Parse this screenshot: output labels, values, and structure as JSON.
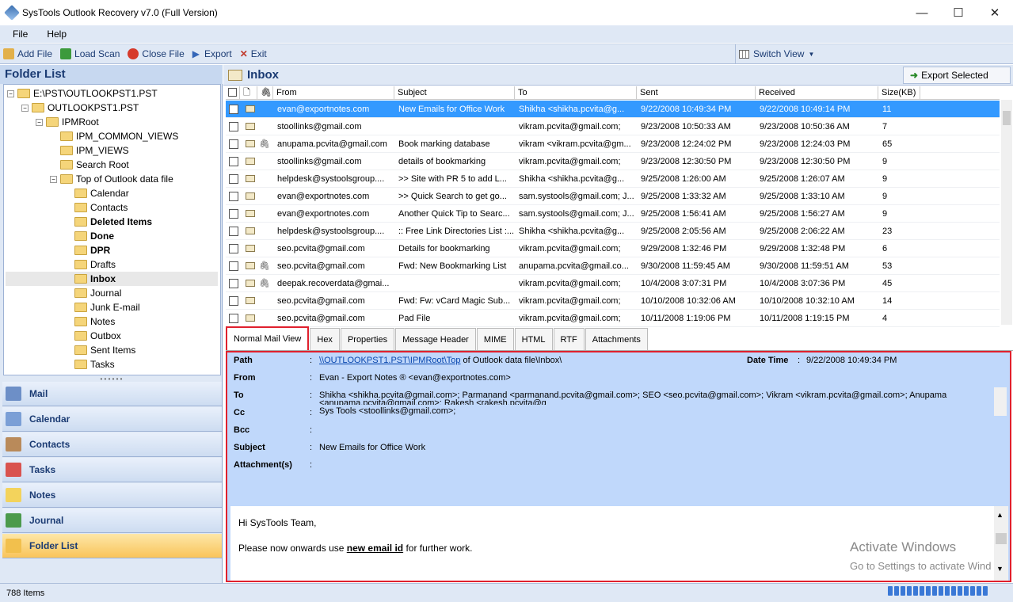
{
  "window": {
    "title": "SysTools Outlook Recovery v7.0 (Full Version)"
  },
  "menu": [
    "File",
    "Help"
  ],
  "toolbar": {
    "items": [
      {
        "label": "Add File",
        "icon": "open-folder-icon",
        "color": "#e2b04a"
      },
      {
        "label": "Load Scan",
        "icon": "download-icon",
        "color": "#3c9a3c"
      },
      {
        "label": "Close File",
        "icon": "close-circle-icon",
        "color": "#d63a2b"
      },
      {
        "label": "Export",
        "icon": "play-arrow-icon",
        "color": "#3466b8"
      },
      {
        "label": "Exit",
        "icon": "cross-icon",
        "color": "#c0392b"
      }
    ],
    "switch_view": "Switch View"
  },
  "folder_list": {
    "title": "Folder List",
    "tree": [
      {
        "label": "E:\\PST\\OUTLOOKPST1.PST",
        "level": 0,
        "exp": "−",
        "bold": false
      },
      {
        "label": "OUTLOOKPST1.PST",
        "level": 1,
        "exp": "−",
        "bold": false
      },
      {
        "label": "IPMRoot",
        "level": 2,
        "exp": "−",
        "bold": false
      },
      {
        "label": "IPM_COMMON_VIEWS",
        "level": 3,
        "exp": "",
        "bold": false
      },
      {
        "label": "IPM_VIEWS",
        "level": 3,
        "exp": "",
        "bold": false
      },
      {
        "label": "Search Root",
        "level": 3,
        "exp": "",
        "bold": false
      },
      {
        "label": "Top of Outlook data file",
        "level": 3,
        "exp": "−",
        "bold": false
      },
      {
        "label": "Calendar",
        "level": 4,
        "exp": "",
        "bold": false
      },
      {
        "label": "Contacts",
        "level": 4,
        "exp": "",
        "bold": false
      },
      {
        "label": "Deleted Items",
        "level": 4,
        "exp": "",
        "bold": true
      },
      {
        "label": "Done",
        "level": 4,
        "exp": "",
        "bold": true
      },
      {
        "label": "DPR",
        "level": 4,
        "exp": "",
        "bold": true
      },
      {
        "label": "Drafts",
        "level": 4,
        "exp": "",
        "bold": false
      },
      {
        "label": "Inbox",
        "level": 4,
        "exp": "",
        "bold": true,
        "selected": true
      },
      {
        "label": "Journal",
        "level": 4,
        "exp": "",
        "bold": false
      },
      {
        "label": "Junk E-mail",
        "level": 4,
        "exp": "",
        "bold": false
      },
      {
        "label": "Notes",
        "level": 4,
        "exp": "",
        "bold": false
      },
      {
        "label": "Outbox",
        "level": 4,
        "exp": "",
        "bold": false
      },
      {
        "label": "Sent Items",
        "level": 4,
        "exp": "",
        "bold": false
      },
      {
        "label": "Tasks",
        "level": 4,
        "exp": "",
        "bold": false
      }
    ],
    "nav": [
      {
        "label": "Mail",
        "icon": "mail-icon",
        "color": "#6d8fc7"
      },
      {
        "label": "Calendar",
        "icon": "calendar-icon",
        "color": "#7b9fd6"
      },
      {
        "label": "Contacts",
        "icon": "contacts-icon",
        "color": "#b98a5a"
      },
      {
        "label": "Tasks",
        "icon": "tasks-icon",
        "color": "#d9534f"
      },
      {
        "label": "Notes",
        "icon": "notes-icon",
        "color": "#f3d35c"
      },
      {
        "label": "Journal",
        "icon": "journal-icon",
        "color": "#4c9a4c"
      },
      {
        "label": "Folder List",
        "icon": "folder-icon",
        "color": "#f2c04d",
        "active": true
      }
    ]
  },
  "inbox": {
    "title": "Inbox",
    "export_selected": "Export Selected",
    "columns": [
      "From",
      "Subject",
      "To",
      "Sent",
      "Received",
      "Size(KB)"
    ],
    "rows": [
      {
        "from": "evan@exportnotes.com",
        "subject": "New Emails for Office Work",
        "to": "Shikha <shikha.pcvita@g...",
        "sent": "9/22/2008 10:49:34 PM",
        "received": "9/22/2008 10:49:14 PM",
        "size": "11",
        "attach": false,
        "selected": true
      },
      {
        "from": "stoollinks@gmail.com",
        "subject": "",
        "to": "vikram.pcvita@gmail.com;",
        "sent": "9/23/2008 10:50:33 AM",
        "received": "9/23/2008 10:50:36 AM",
        "size": "7",
        "attach": false
      },
      {
        "from": "anupama.pcvita@gmail.com",
        "subject": "Book marking database",
        "to": "vikram <vikram.pcvita@gm...",
        "sent": "9/23/2008 12:24:02 PM",
        "received": "9/23/2008 12:24:03 PM",
        "size": "65",
        "attach": true
      },
      {
        "from": "stoollinks@gmail.com",
        "subject": "details of bookmarking",
        "to": "vikram.pcvita@gmail.com;",
        "sent": "9/23/2008 12:30:50 PM",
        "received": "9/23/2008 12:30:50 PM",
        "size": "9",
        "attach": false
      },
      {
        "from": "helpdesk@systoolsgroup....",
        "subject": ">> Site with PR 5 to add L...",
        "to": "Shikha <shikha.pcvita@g...",
        "sent": "9/25/2008 1:26:00 AM",
        "received": "9/25/2008 1:26:07 AM",
        "size": "9",
        "attach": false
      },
      {
        "from": "evan@exportnotes.com",
        "subject": ">> Quick Search to get go...",
        "to": "sam.systools@gmail.com; J...",
        "sent": "9/25/2008 1:33:32 AM",
        "received": "9/25/2008 1:33:10 AM",
        "size": "9",
        "attach": false
      },
      {
        "from": "evan@exportnotes.com",
        "subject": "Another Quick Tip to Searc...",
        "to": "sam.systools@gmail.com; J...",
        "sent": "9/25/2008 1:56:41 AM",
        "received": "9/25/2008 1:56:27 AM",
        "size": "9",
        "attach": false
      },
      {
        "from": "helpdesk@systoolsgroup....",
        "subject": ":: Free Link Directories List :...",
        "to": "Shikha <shikha.pcvita@g...",
        "sent": "9/25/2008 2:05:56 AM",
        "received": "9/25/2008 2:06:22 AM",
        "size": "23",
        "attach": false
      },
      {
        "from": "seo.pcvita@gmail.com",
        "subject": "Details for bookmarking",
        "to": "vikram.pcvita@gmail.com;",
        "sent": "9/29/2008 1:32:46 PM",
        "received": "9/29/2008 1:32:48 PM",
        "size": "6",
        "attach": false
      },
      {
        "from": "seo.pcvita@gmail.com",
        "subject": "Fwd: New Bookmarking List",
        "to": "anupama.pcvita@gmail.co...",
        "sent": "9/30/2008 11:59:45 AM",
        "received": "9/30/2008 11:59:51 AM",
        "size": "53",
        "attach": true
      },
      {
        "from": "deepak.recoverdata@gmai...",
        "subject": "",
        "to": "vikram.pcvita@gmail.com;",
        "sent": "10/4/2008 3:07:31 PM",
        "received": "10/4/2008 3:07:36 PM",
        "size": "45",
        "attach": true
      },
      {
        "from": "seo.pcvita@gmail.com",
        "subject": "Fwd: Fw: vCard Magic Sub...",
        "to": "vikram.pcvita@gmail.com;",
        "sent": "10/10/2008 10:32:06 AM",
        "received": "10/10/2008 10:32:10 AM",
        "size": "14",
        "attach": false
      },
      {
        "from": "seo.pcvita@gmail.com",
        "subject": "Pad File",
        "to": "vikram.pcvita@gmail.com;",
        "sent": "10/11/2008 1:19:06 PM",
        "received": "10/11/2008 1:19:15 PM",
        "size": "4",
        "attach": false
      }
    ]
  },
  "tabs": [
    "Normal Mail View",
    "Hex",
    "Properties",
    "Message Header",
    "MIME",
    "HTML",
    "RTF",
    "Attachments"
  ],
  "preview": {
    "path_label": "Path",
    "path_link": "\\\\OUTLOOKPST1.PST\\IPMRoot\\Top",
    "path_rest": " of Outlook data file\\Inbox\\",
    "datetime_label": "Date Time",
    "datetime_value": "9/22/2008 10:49:34 PM",
    "from_label": "From",
    "from_value": "Evan - Export Notes ® <evan@exportnotes.com>",
    "to_label": "To",
    "to_value": "Shikha <shikha.pcvita@gmail.com>; Parmanand <parmanand.pcvita@gmail.com>; SEO <seo.pcvita@gmail.com>; Vikram <vikram.pcvita@gmail.com>; Anupama",
    "to_value2": "<anupama.pcvita@gmail.com>; Rakesh <rakesh.pcvita@g",
    "cc_label": "Cc",
    "cc_value": "Sys Tools <stoollinks@gmail.com>;",
    "bcc_label": "Bcc",
    "subject_label": "Subject",
    "subject_value": "New Emails for Office Work",
    "attach_label": "Attachment(s)",
    "colon": ":",
    "body_greeting": "Hi SysTools Team,",
    "body_line_pre": "Please now onwards use ",
    "body_line_bold": "new email id",
    "body_line_post": " for further work."
  },
  "watermark": {
    "line1": "Activate Windows",
    "line2": "Go to Settings to activate Wind"
  },
  "status": {
    "items": "788 Items"
  }
}
